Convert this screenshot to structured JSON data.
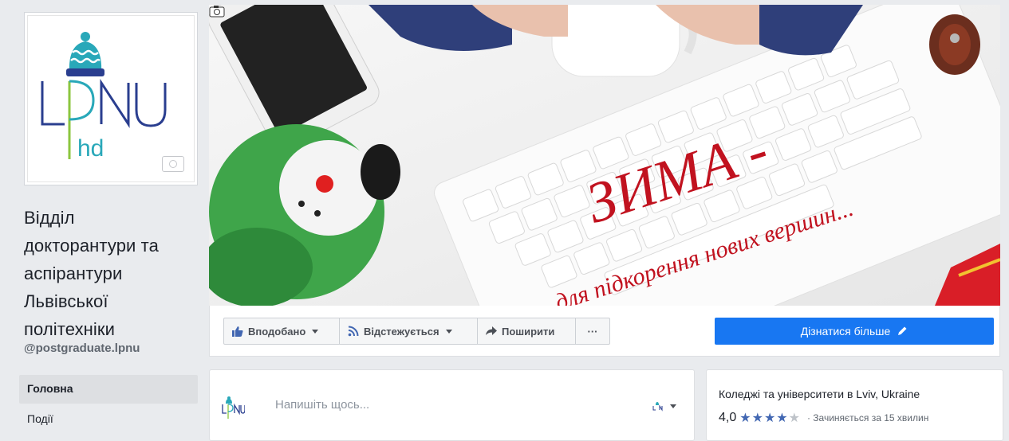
{
  "page": {
    "name": "Відділ докторантури та аспірантури Львівської політехніки",
    "name_lines": [
      "Відділ",
      "докторантури та",
      "аспірантури",
      "Львівської",
      "політехніки"
    ],
    "handle": "@postgraduate.lpnu",
    "logo_text": "LPNU",
    "logo_sub": "hd"
  },
  "nav": {
    "items": [
      {
        "label": "Головна",
        "active": true
      },
      {
        "label": "Події",
        "active": false
      }
    ]
  },
  "cover": {
    "headline": "ЗИМА -",
    "tagline": "для підкорення нових вершин..."
  },
  "actions": {
    "like_label": "Вподобано",
    "follow_label": "Відстежується",
    "share_label": "Поширити",
    "more_label": "···",
    "cta_label": "Дізнатися більше"
  },
  "composer": {
    "placeholder": "Напишіть щось..."
  },
  "info": {
    "category": "Коледжі та університети в Lviv, Ukraine",
    "rating": "4,0",
    "rating_value": 4,
    "rating_max": 5,
    "status": "· Зачиняється за 15 хвилин"
  },
  "colors": {
    "primary": "#1877f2",
    "star": "#4267b2",
    "logo_blue": "#2a3e8f",
    "logo_teal": "#29a8b9",
    "logo_green": "#8cc63f",
    "cover_text": "#c1121f"
  }
}
